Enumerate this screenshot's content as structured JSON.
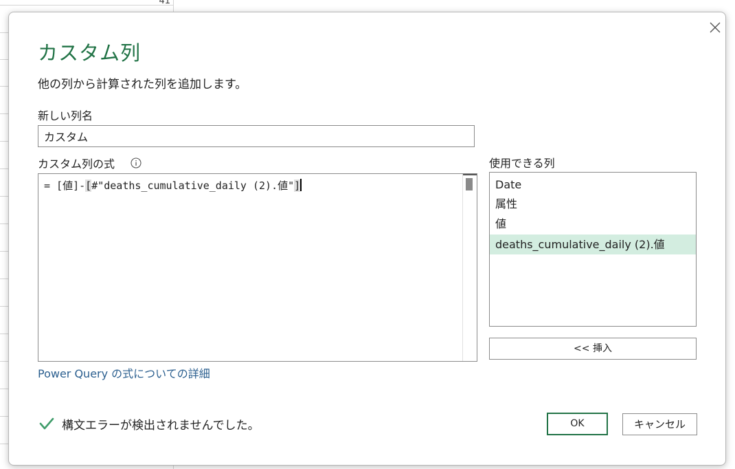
{
  "background": {
    "cell_value": "41"
  },
  "dialog": {
    "title": "カスタム列",
    "subtitle": "他の列から計算された列を追加します。",
    "new_column_label": "新しい列名",
    "new_column_value": "カスタム",
    "formula_label": "カスタム列の式",
    "formula": {
      "prefix": "= [値]-",
      "open_bracket": "[",
      "body": "#\"deaths_cumulative_daily (2).値\"",
      "close_bracket": "]"
    },
    "learn_more_link": "Power Query の式についての詳細",
    "available_columns_label": "使用できる列",
    "available_columns": [
      {
        "label": "Date"
      },
      {
        "label": "属性"
      },
      {
        "label": "値"
      },
      {
        "label": "deaths_cumulative_daily (2).値"
      }
    ],
    "selected_column_index": 3,
    "insert_button": "<< 挿入",
    "status_message": "構文エラーが検出されませんでした。",
    "ok_button": "OK",
    "cancel_button": "キャンセル"
  },
  "colors": {
    "accent_green": "#217346",
    "link_blue": "#2b5f8f",
    "selection_green": "#d3ede0",
    "check_green": "#3f9c6a"
  },
  "icons": {
    "close": "close-icon",
    "info": "info-icon",
    "status": "checkmark-icon"
  }
}
